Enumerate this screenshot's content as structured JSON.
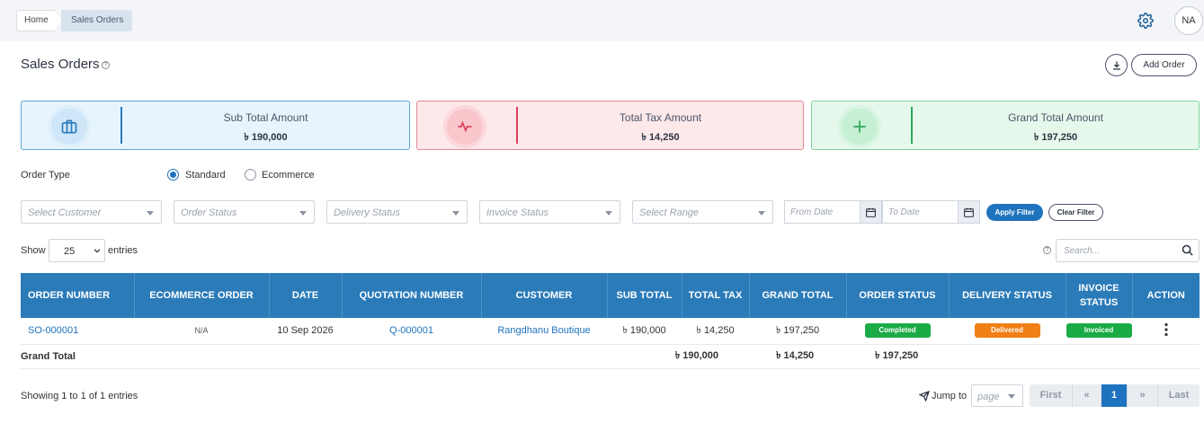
{
  "breadcrumb": {
    "home": "Home",
    "current": "Sales Orders"
  },
  "header": {
    "avatar_initials": "NA"
  },
  "page": {
    "title": "Sales Orders",
    "help_glyph": "?",
    "add_order_label": "Add Order"
  },
  "cards": [
    {
      "label": "Sub Total Amount",
      "value": "৳ 190,000",
      "accent": "#2b7bb9",
      "icon": "briefcase-icon"
    },
    {
      "label": "Total Tax Amount",
      "value": "৳ 14,250",
      "accent": "#d9425a",
      "icon": "pulse-icon"
    },
    {
      "label": "Grand Total Amount",
      "value": "৳ 197,250",
      "accent": "#2ea85a",
      "icon": "plus-icon"
    }
  ],
  "order_type": {
    "label": "Order Type",
    "options": [
      "Standard",
      "Ecommerce"
    ],
    "selected": "Standard"
  },
  "filters": {
    "customer_placeholder": "Select Customer",
    "order_status_placeholder": "Order Status",
    "delivery_status_placeholder": "Delivery Status",
    "invoice_status_placeholder": "Invoice Status",
    "range_placeholder": "Select Range",
    "from_date_placeholder": "From Date",
    "to_date_placeholder": "To Date",
    "apply_label": "Apply Filter",
    "clear_label": "Clear Filter"
  },
  "list_controls": {
    "show_label": "Show",
    "entries_value": "25",
    "entries_label": "entries",
    "search_placeholder": "Search..."
  },
  "table": {
    "headers": [
      "ORDER NUMBER",
      "ECOMMERCE ORDER",
      "DATE",
      "QUOTATION NUMBER",
      "CUSTOMER",
      "SUB TOTAL",
      "TOTAL TAX",
      "GRAND TOTAL",
      "ORDER STATUS",
      "DELIVERY STATUS",
      "INVOICE STATUS",
      "ACTION"
    ],
    "rows": [
      {
        "order_number": "SO-000001",
        "ecommerce_order": "N/A",
        "date": "10 Sep 2026",
        "quotation_number": "Q-000001",
        "customer": "Rangdhanu Boutique",
        "sub_total": "৳ 190,000",
        "total_tax": "৳ 14,250",
        "grand_total": "৳ 197,250",
        "order_status": "Completed",
        "delivery_status": "Delivered",
        "invoice_status": "Invoiced"
      }
    ],
    "totals": {
      "label": "Grand Total",
      "sub_total": "৳ 190,000",
      "total_tax": "৳ 14,250",
      "grand_total": "৳ 197,250"
    }
  },
  "footer": {
    "showing_text": "Showing 1 to 1 of 1 entries",
    "jump_label": "Jump to",
    "page_placeholder": "page",
    "pagination": {
      "first": "First",
      "prev": "«",
      "current": "1",
      "next": "»",
      "last": "Last"
    }
  },
  "colors": {
    "primary": "#2b7bb9",
    "link": "#1e73be",
    "success": "#1aab46",
    "warning": "#f07f15"
  }
}
